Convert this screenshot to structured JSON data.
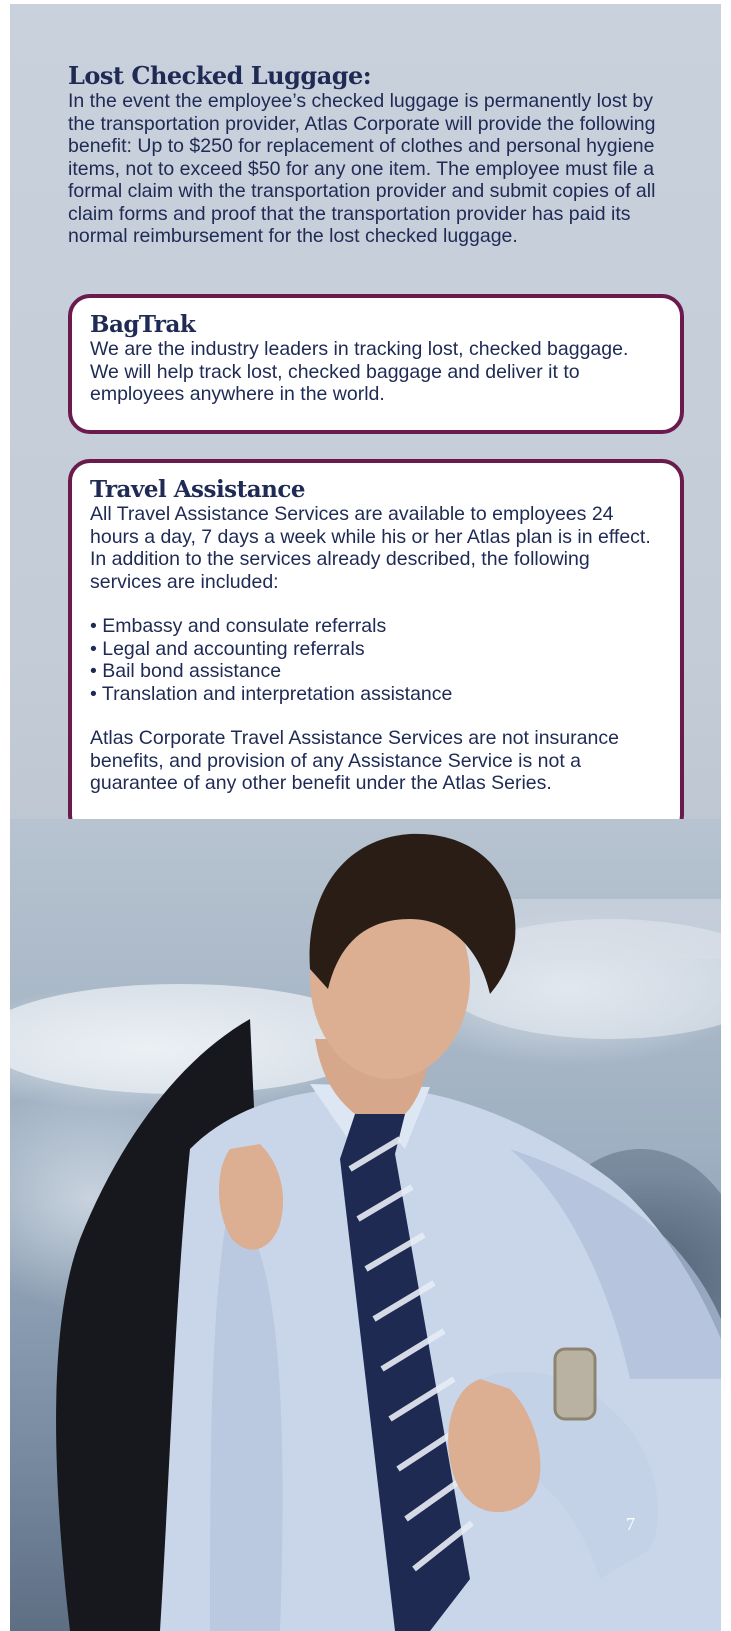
{
  "lost_luggage": {
    "title": "Lost Checked Luggage:",
    "body": "In the event the employee’s checked luggage is permanently lost by the transportation provider, Atlas Corporate will provide the following benefit: Up to $250 for replacement of clothes and personal hygiene items, not to exceed $50 for any one item. The employee must file a formal claim with the transportation provider and submit copies of all claim forms and proof that the transportation provider has paid its normal reimbursement for the lost checked luggage."
  },
  "bagtrak": {
    "title": "BagTrak",
    "body": "We are the industry leaders in tracking lost, checked baggage. We will help track lost, checked baggage and deliver it to employees anywhere in the world."
  },
  "travel_assistance": {
    "title": "Travel Assistance",
    "intro": "All Travel Assistance Services are available to employees 24 hours a day, 7 days a week while his or her Atlas plan is in effect.  In addition to the services already described, the following services are included:",
    "bullets": [
      "• Embassy and consulate referrals",
      "• Legal and accounting referrals",
      "• Bail bond assistance",
      "• Translation and interpretation assistance"
    ],
    "disclaimer": "Atlas Corporate Travel Assistance Services are not insurance benefits, and provision of any Assistance Service is not a guarantee of any other benefit under the Atlas Series."
  },
  "page_number": "7"
}
